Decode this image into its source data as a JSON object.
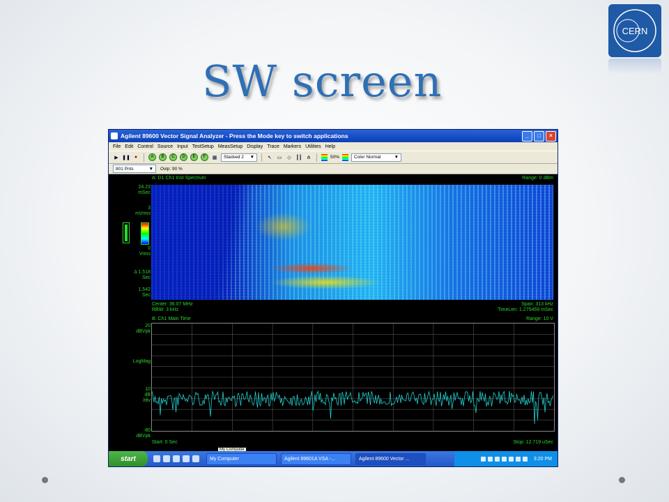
{
  "slide": {
    "title": "SW screen",
    "logo_text": "CERN"
  },
  "window": {
    "title": "Agilent 89600 Vector Signal Analyzer - Press the Mode key to switch applications",
    "menu": [
      "File",
      "Edit",
      "Control",
      "Source",
      "Input",
      "TestSetup",
      "MeasSetup",
      "Display",
      "Trace",
      "Markers",
      "Utilities",
      "Help"
    ],
    "toolbar": {
      "trace_buttons": [
        "A",
        "B",
        "C",
        "D",
        "E",
        "F"
      ],
      "layout_select": "Stacked 2",
      "percent": "50%",
      "color_select": "Color Normal",
      "points_select": "801 Pnts",
      "overlap": "Ovlp: 90 %"
    }
  },
  "traceA": {
    "header_left": "A: D1 Ch1 Inst Spectrum",
    "header_right": "Range: 0 dBm",
    "y_labels": [
      [
        "24.23",
        "mSec"
      ],
      [
        "3",
        "mVrms"
      ],
      [
        "0",
        "Vrms"
      ],
      [
        "Δ 1.518",
        "Sec"
      ],
      [
        "1.542",
        "Sec"
      ]
    ],
    "footer_left1": "Center: 36.07 MHz",
    "footer_left2": "RBW: 3 kHz",
    "footer_right1": "Span: 313 kHz",
    "footer_right2": "TimeLen: 1.275459 mSec"
  },
  "traceB": {
    "header_left": "B: Ch1 Main Time",
    "header_right": "Range: 10  V",
    "y_labels": [
      [
        "20",
        "dBVpk"
      ],
      [
        "LogMag"
      ],
      [
        "10",
        "dB",
        "/div"
      ],
      [
        "-80",
        "dBVpk"
      ]
    ],
    "footer_left": "Start: 0  Sec",
    "footer_right": "Stop: 12.719 uSec"
  },
  "taskbar": {
    "start": "start",
    "tasks": [
      "My Computer",
      "Agilent 89601A VSA -...",
      "Agilent 89600 Vector ..."
    ],
    "clock": "3:20 PM",
    "tooltip": "My Computer"
  }
}
